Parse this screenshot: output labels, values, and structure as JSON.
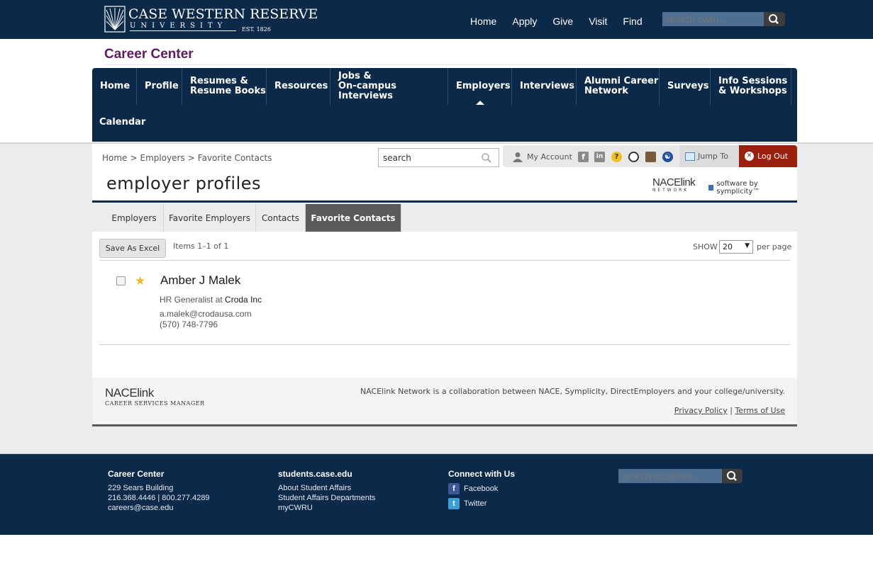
{
  "university": {
    "name_line1": "CASE WESTERN RESERVE",
    "name_line2": "UNIVERSITY",
    "est": "EST. 1826"
  },
  "top_nav": [
    "Home",
    "Apply",
    "Give",
    "Visit",
    "Find"
  ],
  "top_search": {
    "placeholder": "search cwru..."
  },
  "site_title": "Career Center",
  "main_nav": {
    "items": [
      "Home",
      "Profile",
      "Resumes &\nResume Books",
      "Resources",
      "Jobs &\nOn-campus Interviews",
      "Employers",
      "Interviews",
      "Alumni Career\nNetwork",
      "Surveys",
      "Info Sessions\n& Workshops"
    ],
    "active": "Employers",
    "second_row": "Calendar"
  },
  "breadcrumb": [
    "Home",
    ">",
    "Employers",
    ">",
    "Favorite Contacts"
  ],
  "site_search": {
    "value": "search"
  },
  "toolbar": {
    "my_account": "My Account",
    "jump_to": "Jump To",
    "log_out": "Log Out"
  },
  "page_title": "employer profiles",
  "header_brand": {
    "nacelink": "NACElink",
    "nacelink_sub": "N E T W O R K",
    "symplicity": "software by symplicity™"
  },
  "subtabs": {
    "items": [
      "Employers",
      "Favorite Employers",
      "Contacts",
      "Favorite Contacts"
    ],
    "active": "Favorite Contacts"
  },
  "listing": {
    "save_excel": "Save As Excel",
    "items_count": "Items 1–1 of 1",
    "show_label": "SHOW",
    "per_page_value": "20",
    "per_page_suffix": "per page"
  },
  "contact": {
    "name": "Amber J Malek",
    "title_prefix": "HR Generalist at",
    "organization": "Croda Inc",
    "email": "a.malek@crodausa.com",
    "phone": "(570) 748-7796"
  },
  "inner_footer": {
    "brand": "NACElink",
    "brand_sub": "CAREER SERVICES MANAGER",
    "note": "NACElink Network is a collaboration between NACE, Symplicity, DirectEmployers and your college/university.",
    "privacy": "Privacy Policy",
    "separator": "|",
    "terms": "Terms of Use"
  },
  "site_footer": {
    "career_center": {
      "heading": "Career Center",
      "lines": [
        "229 Sears Building",
        "216.368.4446 | 800.277.4289",
        "careers@case.edu"
      ]
    },
    "students": {
      "heading": "students.case.edu",
      "lines": [
        "About Student Affairs",
        "Student Affairs Departments",
        "myCWRU"
      ]
    },
    "connect": {
      "heading": "Connect with Us",
      "facebook": "Facebook",
      "twitter": "Twitter"
    },
    "search": {
      "placeholder": "search students..."
    }
  },
  "colors": {
    "navy": "#0b2a4a",
    "career_title": "#5e1a62",
    "logout_red": "#9a1f0f",
    "active_tab": "#5a5a5a",
    "star": "#f3b81f"
  }
}
